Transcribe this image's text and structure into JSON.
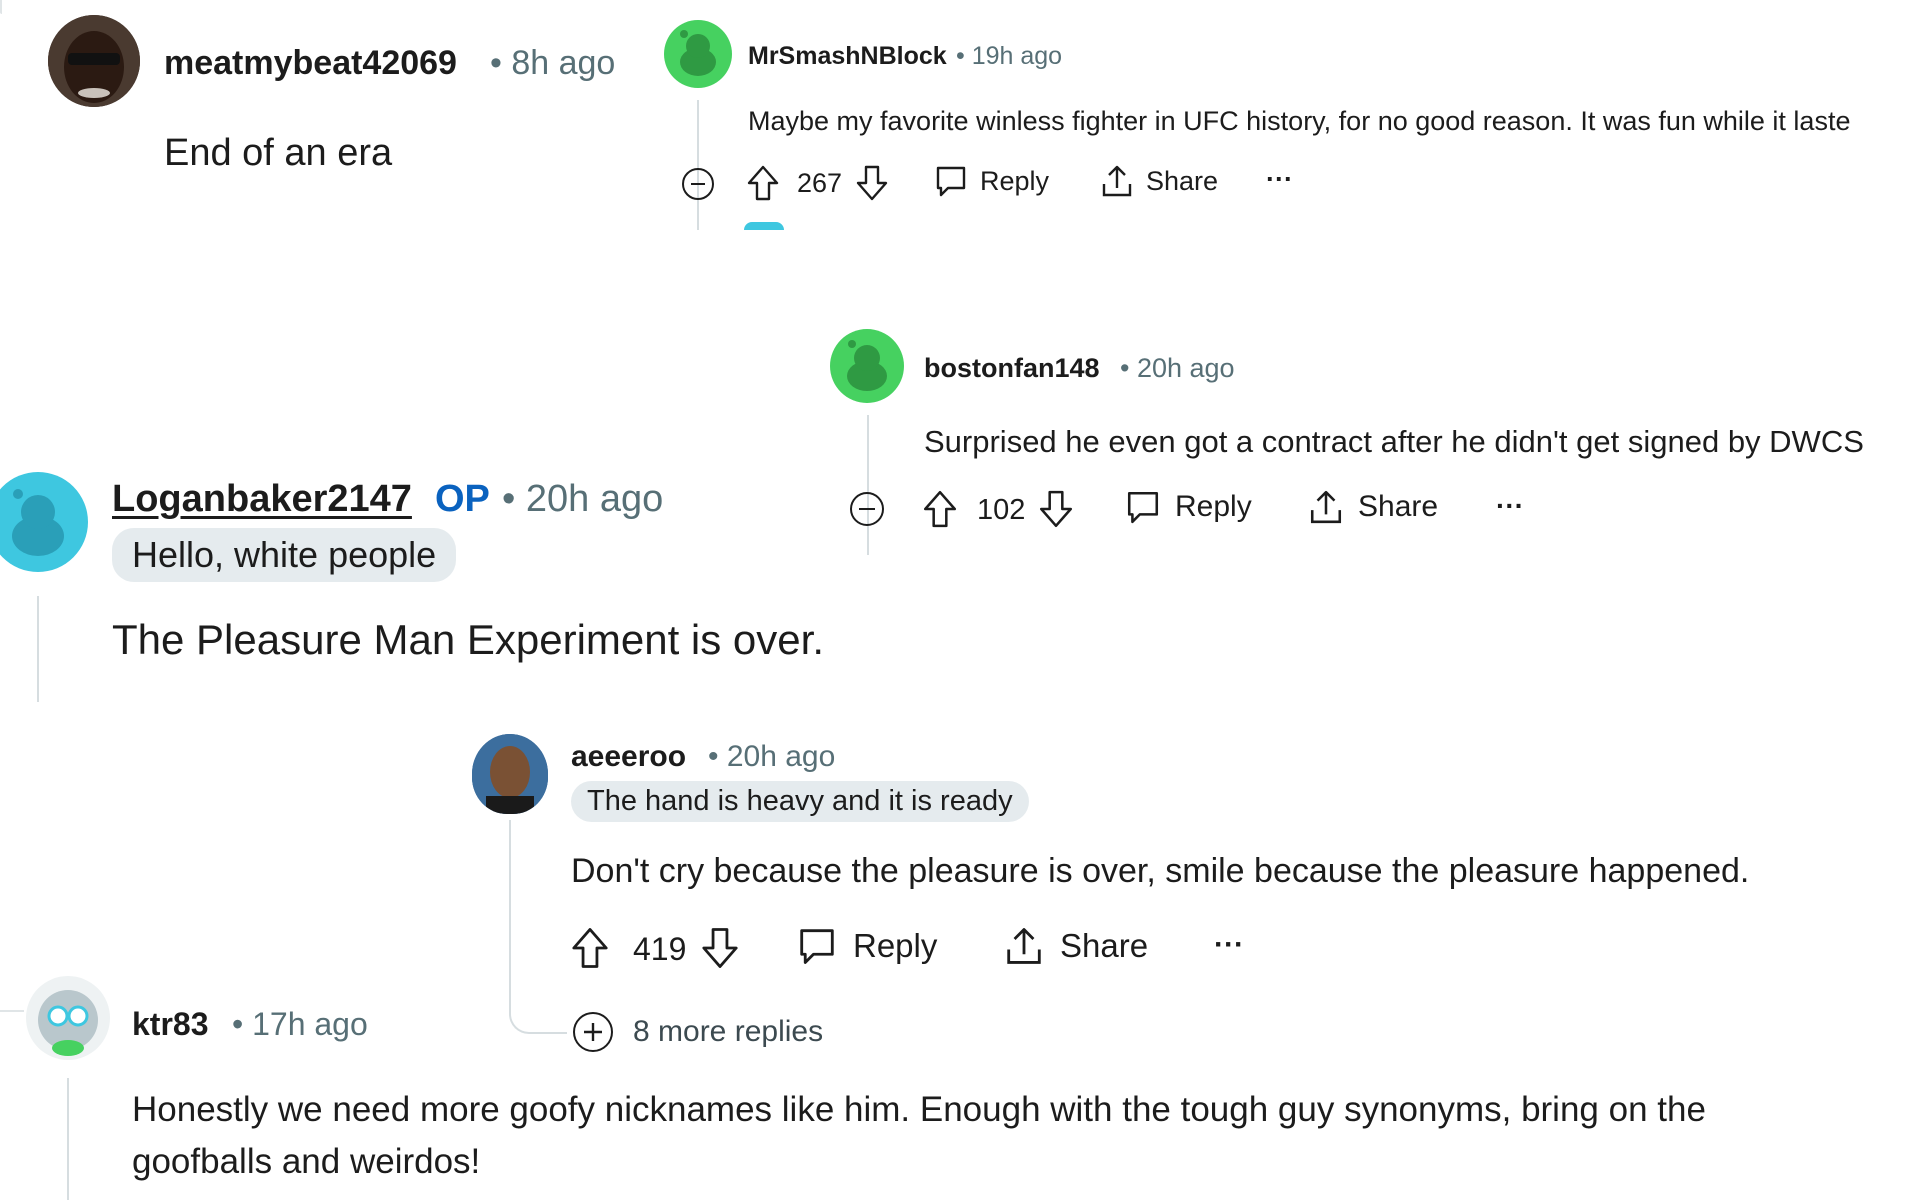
{
  "comments": {
    "meat": {
      "username": "meatmybeat42069",
      "time": "• 8h ago",
      "body": "End of an era"
    },
    "smash": {
      "username": "MrSmashNBlock",
      "time": "• 19h ago",
      "body": "Maybe my favorite winless fighter in UFC history, for no good reason. It was fun while it laste",
      "votes": "267",
      "reply_label": "Reply",
      "share_label": "Share",
      "more_label": "···"
    },
    "boston": {
      "username": "bostonfan148",
      "time": "• 20h ago",
      "body": "Surprised he even got a contract after he didn't get signed by DWCS",
      "votes": "102",
      "reply_label": "Reply",
      "share_label": "Share",
      "more_label": "···"
    },
    "logan": {
      "username": "Loganbaker2147",
      "op": "OP",
      "time": "• 20h ago",
      "flair": "Hello, white people",
      "body": "The Pleasure Man Experiment is over."
    },
    "aeeeroo": {
      "username": "aeeeroo",
      "time": "• 20h ago",
      "flair": "The hand is heavy and it is ready",
      "body": "Don't cry because the pleasure is over, smile because the pleasure happened.",
      "votes": "419",
      "reply_label": "Reply",
      "share_label": "Share",
      "more_label": "···",
      "more_replies": "8 more replies"
    },
    "ktr": {
      "username": "ktr83",
      "time": "• 17h ago",
      "body_line1": "Honestly we need more goofy nicknames like him. Enough with the tough guy synonyms, bring on the",
      "body_line2": "goofballs and weirdos!"
    }
  },
  "icons": [
    "upvote-icon",
    "downvote-icon",
    "reply-bubble-icon",
    "share-icon",
    "collapse-minus-icon",
    "expand-plus-icon",
    "snoo-avatar-icon"
  ],
  "colors": {
    "op_blue": "#0a62bf",
    "link_underline": "#1c1c1c",
    "meta_gray": "#576f76",
    "flair_bg": "#e5ebee",
    "snoo_green": "#46d160",
    "snoo_teal": "#3ec7e0"
  }
}
